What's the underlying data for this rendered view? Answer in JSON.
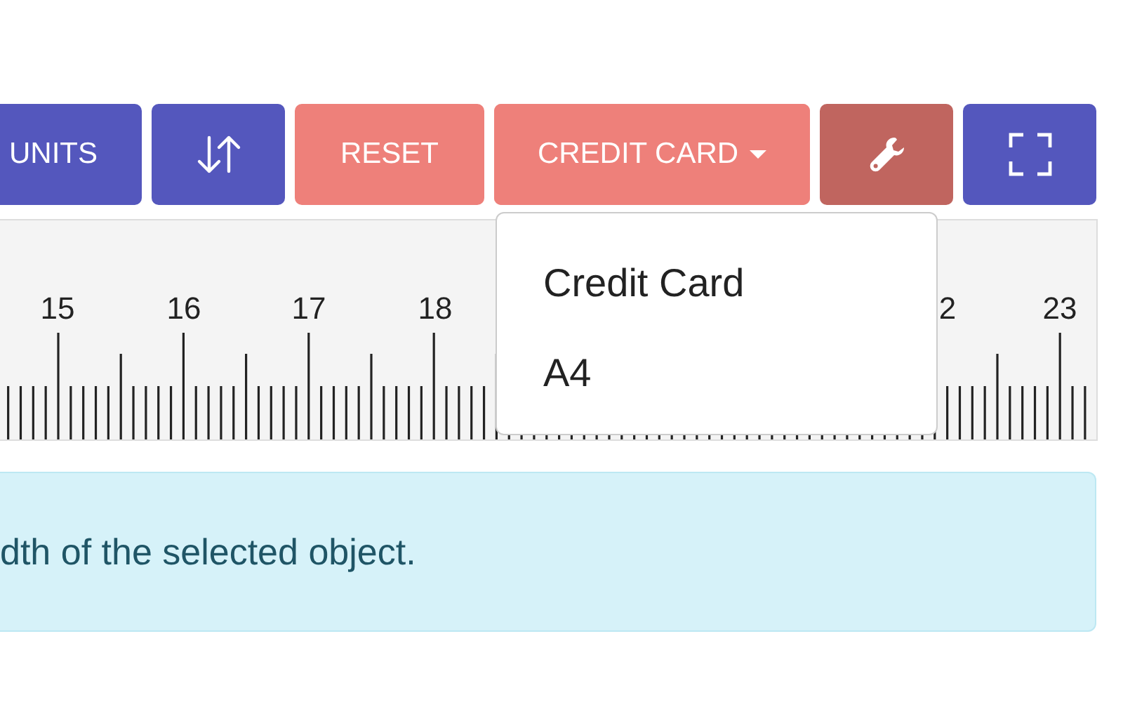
{
  "toolbar": {
    "units_button": {
      "label": "UNITS"
    },
    "reset_button": {
      "label": "RESET"
    },
    "size_dropdown": {
      "label": "CREDIT CARD",
      "expanded": true,
      "options": [
        {
          "label": "Credit Card"
        },
        {
          "label": "A4"
        }
      ]
    },
    "tools_button": {
      "pressed": true
    }
  },
  "ruler": {
    "labels": [
      "15",
      "16",
      "17",
      "18",
      "2",
      "23"
    ]
  },
  "info": {
    "text": "dth of the selected object."
  }
}
